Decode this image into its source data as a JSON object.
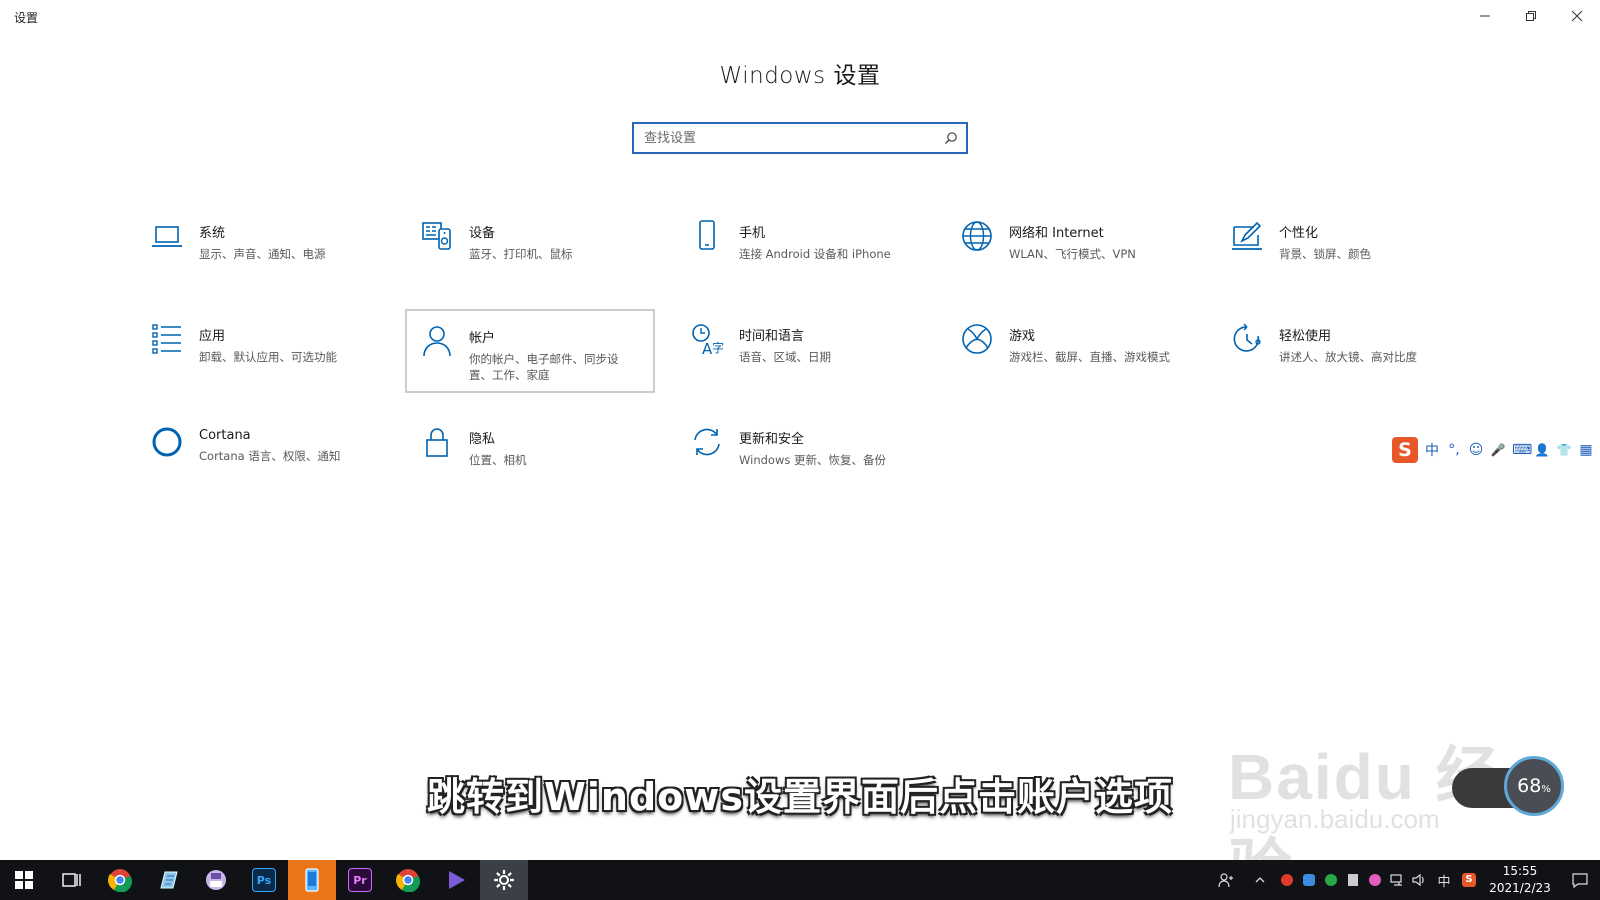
{
  "window": {
    "title": "设置",
    "controls": [
      "minimize-icon",
      "restore-icon",
      "close-icon"
    ]
  },
  "page": {
    "title": "Windows 设置"
  },
  "search": {
    "placeholder": "查找设置"
  },
  "categories": [
    {
      "icon": "laptop-icon",
      "name": "系统",
      "desc": "显示、声音、通知、电源"
    },
    {
      "icon": "devices-icon",
      "name": "设备",
      "desc": "蓝牙、打印机、鼠标"
    },
    {
      "icon": "phone-icon",
      "name": "手机",
      "desc": "连接 Android 设备和 iPhone"
    },
    {
      "icon": "globe-icon",
      "name": "网络和 Internet",
      "desc": "WLAN、飞行模式、VPN"
    },
    {
      "icon": "personalization-icon",
      "name": "个性化",
      "desc": "背景、锁屏、颜色"
    },
    {
      "icon": "apps-list-icon",
      "name": "应用",
      "desc": "卸载、默认应用、可选功能"
    },
    {
      "icon": "person-icon",
      "name": "帐户",
      "desc": "你的帐户、电子邮件、同步设置、工作、家庭",
      "selected": true
    },
    {
      "icon": "time-language-icon",
      "name": "时间和语言",
      "desc": "语音、区域、日期"
    },
    {
      "icon": "xbox-icon",
      "name": "游戏",
      "desc": "游戏栏、截屏、直播、游戏模式"
    },
    {
      "icon": "ease-of-access-icon",
      "name": "轻松使用",
      "desc": "讲述人、放大镜、高对比度"
    },
    {
      "icon": "cortana-icon",
      "name": "Cortana",
      "desc": "Cortana 语言、权限、通知"
    },
    {
      "icon": "lock-icon",
      "name": "隐私",
      "desc": "位置、相机"
    },
    {
      "icon": "sync-icon",
      "name": "更新和安全",
      "desc": "Windows 更新、恢复、备份"
    }
  ],
  "ime": {
    "logo": "S",
    "items": [
      "中",
      "°,",
      "☺",
      "🎤",
      "⌨",
      "👤",
      "👕",
      "▦"
    ]
  },
  "subtitle": "跳转到Windows设置界面后点击账户选项",
  "watermark": {
    "main": "Baidu 经验",
    "sub": "jingyan.baidu.com"
  },
  "memory_widget": {
    "value": "68",
    "unit": "%"
  },
  "taskbar": {
    "apps": [
      "start-icon",
      "task-view-icon",
      "chrome-icon",
      "notepad-icon",
      "disk-icon",
      "photoshop-icon",
      "phone-app-icon",
      "premiere-icon",
      "chrome-icon",
      "media-player-icon",
      "settings-icon"
    ],
    "photoshop_label": "Ps",
    "premiere_label": "Pr"
  },
  "tray": {
    "input_indicator": "中",
    "time": "15:55",
    "date": "2021/2/23"
  },
  "colors": {
    "accent": "#0063b1",
    "search_border": "#2a66b8",
    "taskbar": "#101216"
  }
}
